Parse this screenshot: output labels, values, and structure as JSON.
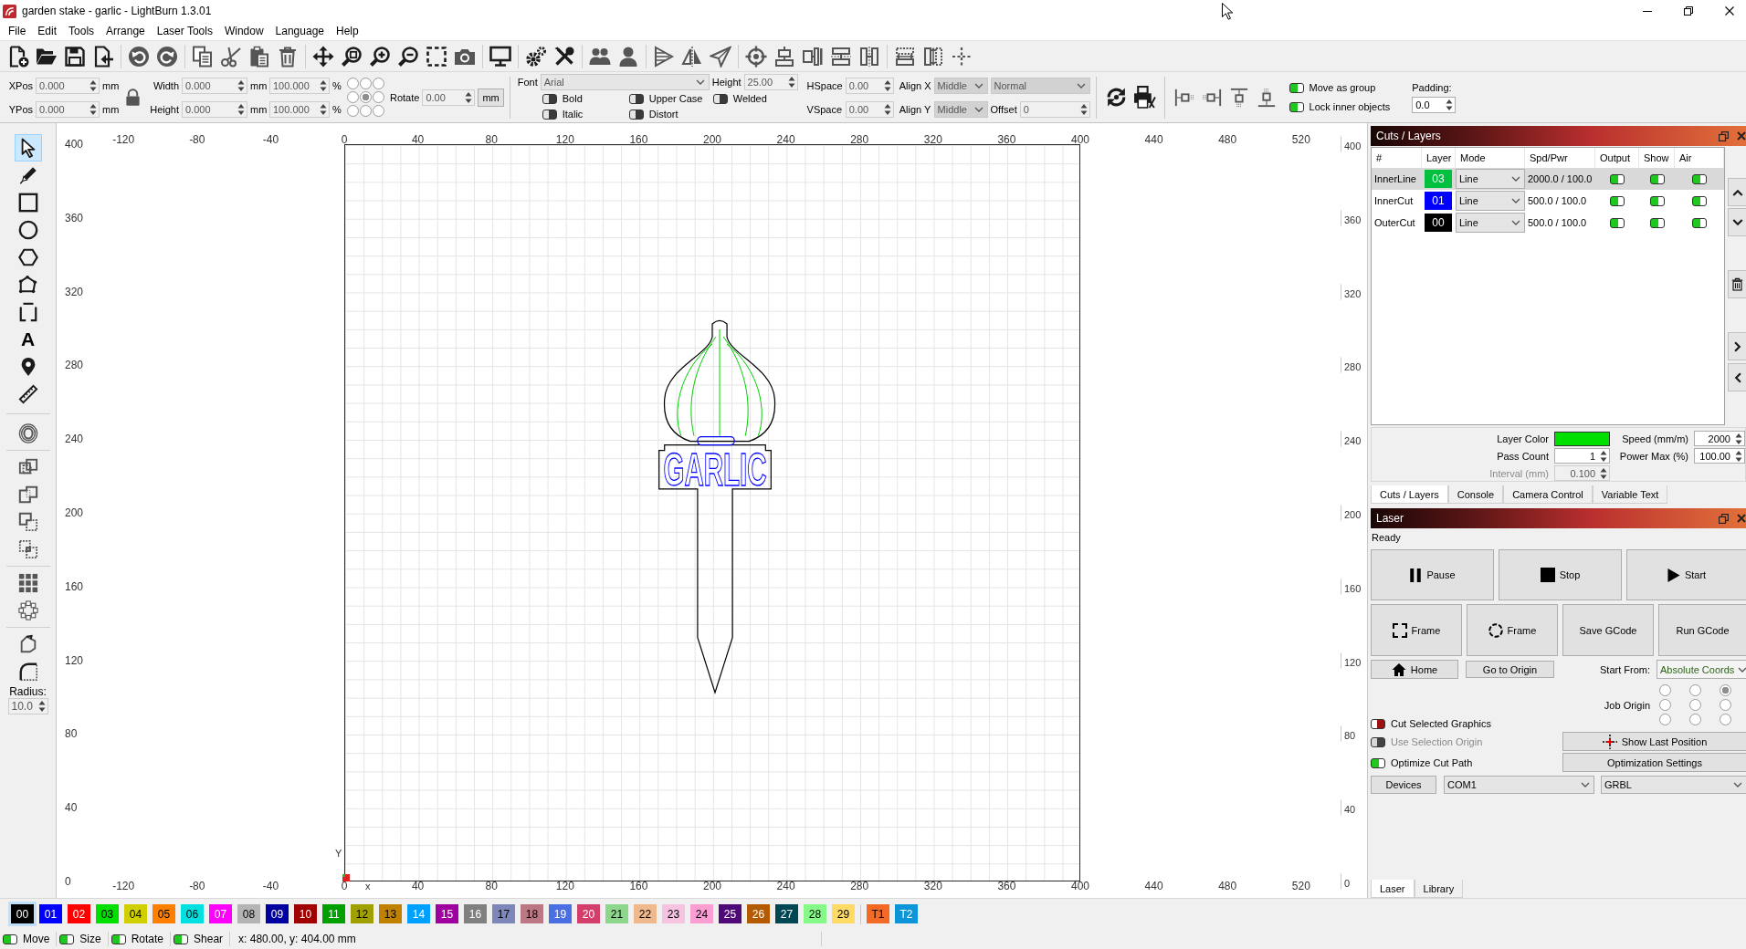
{
  "window": {
    "title": "garden stake - garlic - LightBurn 1.3.01"
  },
  "menu": [
    "File",
    "Edit",
    "Tools",
    "Arrange",
    "Laser Tools",
    "Window",
    "Language",
    "Help"
  ],
  "properties": {
    "position": [
      {
        "label": "XPos",
        "value": "0.000",
        "unit": "mm",
        "disabled": true
      },
      {
        "label": "YPos",
        "value": "0.000",
        "unit": "mm",
        "disabled": true
      }
    ],
    "size": [
      {
        "label": "Width",
        "value": "0.000",
        "unit": "mm",
        "percent": "100.000",
        "percent_unit": "%",
        "disabled": true
      },
      {
        "label": "Height",
        "value": "0.000",
        "unit": "mm",
        "percent": "100.000",
        "percent_unit": "%",
        "disabled": true
      }
    ],
    "origin_points": [
      {
        "selected": false
      },
      {
        "selected": false
      },
      {
        "selected": false
      },
      {
        "selected": false
      },
      {
        "selected": true
      },
      {
        "selected": false
      },
      {
        "selected": false
      },
      {
        "selected": false
      },
      {
        "selected": false
      }
    ],
    "rotate": {
      "label": "Rotate",
      "value": "0.00",
      "disabled": true
    },
    "units_button": "mm",
    "font": {
      "label": "Font",
      "value": "Arial",
      "disabled": true
    },
    "text_height": {
      "label": "Height",
      "value": "25.00",
      "disabled": true
    },
    "text_options": [
      {
        "label": "Bold",
        "on": false
      },
      {
        "label": "Italic",
        "on": false
      },
      {
        "label": "Upper Case",
        "on": false
      },
      {
        "label": "Distort",
        "on": false
      },
      {
        "label": "Welded",
        "on": false
      }
    ],
    "spacing": [
      {
        "label": "HSpace",
        "value": "0.00",
        "disabled": true
      },
      {
        "label": "VSpace",
        "value": "0.00",
        "disabled": true
      }
    ],
    "align": [
      {
        "label": "Align X",
        "value": "Middle",
        "disabled": true
      },
      {
        "label": "Align Y",
        "value": "Middle",
        "disabled": true
      }
    ],
    "text_mode": {
      "value": "Normal",
      "disabled": true
    },
    "offset": {
      "label": "Offset",
      "value": "0",
      "disabled": true
    },
    "group_options": [
      {
        "label": "Move as group",
        "on": true
      },
      {
        "label": "Lock inner objects",
        "on": true
      }
    ],
    "padding": {
      "label": "Padding:",
      "value": "0.0"
    }
  },
  "toolbox": {
    "tools": [
      {
        "selected": true
      },
      {
        "selected": false
      },
      {
        "selected": false
      },
      {
        "selected": false
      },
      {
        "selected": false
      },
      {
        "selected": false
      },
      {
        "selected": false
      },
      {
        "selected": false
      },
      {
        "selected": false
      },
      {
        "selected": false
      }
    ],
    "text_tool_label": "A",
    "radius": {
      "label": "Radius:",
      "value": "10.0",
      "disabled": true
    }
  },
  "canvas": {
    "top_ruler": [
      "-120",
      "-80",
      "-40",
      "0",
      "40",
      "80",
      "120",
      "160",
      "200",
      "240",
      "280",
      "320",
      "360",
      "400",
      "440",
      "480",
      "520"
    ],
    "left_ruler": [
      "400",
      "360",
      "320",
      "280",
      "240",
      "200",
      "160",
      "120",
      "80",
      "40",
      "0"
    ],
    "right_ruler": [
      "400",
      "360",
      "320",
      "280",
      "240",
      "200",
      "160",
      "120",
      "80",
      "40",
      "0"
    ],
    "bottom_ruler": [
      "-120",
      "-80",
      "-40",
      "0",
      "40",
      "80",
      "120",
      "160",
      "200",
      "240",
      "280",
      "320",
      "360",
      "400",
      "440",
      "480",
      "520"
    ],
    "x_axis_label": "x",
    "y_axis_label": "Y",
    "design_text": "GARLIC"
  },
  "cuts_layers": {
    "title": "Cuts / Layers",
    "columns": [
      "#",
      "Layer",
      "Mode",
      "Spd/Pwr",
      "Output",
      "Show",
      "Air"
    ],
    "rows": [
      {
        "name": "InnerLine",
        "layer": "03",
        "color": "#00c040",
        "mode": "Line",
        "speed_power": "2000.0 / 100.0",
        "output": true,
        "show": true,
        "air": true,
        "selected": true
      },
      {
        "name": "InnerCut",
        "layer": "01",
        "color": "#0000ff",
        "mode": "Line",
        "speed_power": "500.0 / 100.0",
        "output": true,
        "show": true,
        "air": true,
        "selected": false
      },
      {
        "name": "OuterCut",
        "layer": "00",
        "color": "#000000",
        "mode": "Line",
        "speed_power": "500.0 / 100.0",
        "output": true,
        "show": true,
        "air": true,
        "selected": false
      }
    ],
    "layer_color": {
      "label": "Layer Color",
      "color": "#00e000"
    },
    "speed": {
      "label": "Speed (mm/m)",
      "value": "2000"
    },
    "pass_count": {
      "label": "Pass Count",
      "value": "1"
    },
    "power_max": {
      "label": "Power Max (%)",
      "value": "100.00"
    },
    "interval": {
      "label": "Interval (mm)",
      "value": "0.100",
      "disabled": true
    },
    "tabs": [
      {
        "label": "Cuts / Layers",
        "selected": true
      },
      {
        "label": "Console",
        "selected": false
      },
      {
        "label": "Camera Control",
        "selected": false
      },
      {
        "label": "Variable Text",
        "selected": false
      }
    ]
  },
  "laser": {
    "title": "Laser",
    "status": "Ready",
    "run_buttons": [
      {
        "label": "Pause",
        "kind": "pause"
      },
      {
        "label": "Stop",
        "kind": "stop"
      },
      {
        "label": "Start",
        "kind": "start"
      }
    ],
    "job_buttons": [
      {
        "label": "Frame",
        "kind": "frame"
      },
      {
        "label": "Frame",
        "kind": "circle_frame"
      },
      {
        "label": "Save GCode",
        "kind": "save_gcode"
      },
      {
        "label": "Run GCode",
        "kind": "run_gcode"
      }
    ],
    "home_button": "Home",
    "go_to_origin_button": "Go to Origin",
    "start_from": {
      "label": "Start From:",
      "value": "Absolute Coords"
    },
    "job_origin": {
      "label": "Job Origin",
      "points": [
        {
          "selected": false
        },
        {
          "selected": false
        },
        {
          "selected": true
        },
        {
          "selected": false
        },
        {
          "selected": false
        },
        {
          "selected": false
        },
        {
          "selected": false
        },
        {
          "selected": false
        },
        {
          "selected": false
        }
      ]
    },
    "options": [
      {
        "label": "Cut Selected Graphics",
        "on": false,
        "disabled": false
      },
      {
        "label": "Use Selection Origin",
        "on": false,
        "disabled": true
      },
      {
        "label": "Optimize Cut Path",
        "on": true,
        "disabled": false
      }
    ],
    "show_last_position_button": "Show Last Position",
    "optimization_settings_button": "Optimization Settings",
    "devices_button": "Devices",
    "port": "COM1",
    "controller": "GRBL",
    "tabs": [
      {
        "label": "Laser",
        "selected": true
      },
      {
        "label": "Library",
        "selected": false
      }
    ]
  },
  "palette": {
    "layers": [
      {
        "label": "00",
        "color": "#000000",
        "selected": true
      },
      {
        "label": "01",
        "color": "#0000ff",
        "selected": false
      },
      {
        "label": "02",
        "color": "#ff0000",
        "selected": false
      },
      {
        "label": "03",
        "color": "#00e000",
        "selected": false
      },
      {
        "label": "04",
        "color": "#d0d000",
        "selected": false
      },
      {
        "label": "05",
        "color": "#ff8000",
        "selected": false
      },
      {
        "label": "06",
        "color": "#00e0e0",
        "selected": false
      },
      {
        "label": "07",
        "color": "#ff00ff",
        "selected": false
      },
      {
        "label": "08",
        "color": "#b4b4b4",
        "selected": false
      },
      {
        "label": "09",
        "color": "#0000a0",
        "selected": false
      },
      {
        "label": "10",
        "color": "#a00000",
        "selected": false
      },
      {
        "label": "11",
        "color": "#00a000",
        "selected": false
      },
      {
        "label": "12",
        "color": "#a0a000",
        "selected": false
      },
      {
        "label": "13",
        "color": "#c08000",
        "selected": false
      },
      {
        "label": "14",
        "color": "#00a0ff",
        "selected": false
      },
      {
        "label": "15",
        "color": "#a000a0",
        "selected": false
      },
      {
        "label": "16",
        "color": "#808080",
        "selected": false
      },
      {
        "label": "17",
        "color": "#7d87b9",
        "selected": false
      },
      {
        "label": "18",
        "color": "#bb7784",
        "selected": false
      },
      {
        "label": "19",
        "color": "#4a6fe3",
        "selected": false
      },
      {
        "label": "20",
        "color": "#d33f6a",
        "selected": false
      },
      {
        "label": "21",
        "color": "#8cd78c",
        "selected": false
      },
      {
        "label": "22",
        "color": "#f0b98d",
        "selected": false
      },
      {
        "label": "23",
        "color": "#f6c4e1",
        "selected": false
      },
      {
        "label": "24",
        "color": "#fa9ed4",
        "selected": false
      },
      {
        "label": "25",
        "color": "#500a78",
        "selected": false
      },
      {
        "label": "26",
        "color": "#b45a00",
        "selected": false
      },
      {
        "label": "27",
        "color": "#004754",
        "selected": false
      },
      {
        "label": "28",
        "color": "#86fa88",
        "selected": false
      },
      {
        "label": "29",
        "color": "#ffdb66",
        "selected": false
      }
    ],
    "tool_layers": [
      {
        "label": "T1",
        "color": "#f36926",
        "selected": false
      },
      {
        "label": "T2",
        "color": "#0c95d8",
        "selected": false
      }
    ]
  },
  "status_bar": {
    "toggles": [
      {
        "label": "Move",
        "on": true
      },
      {
        "label": "Size",
        "on": true
      },
      {
        "label": "Rotate",
        "on": true
      },
      {
        "label": "Shear",
        "on": true
      }
    ],
    "coordinates": "x: 480.00, y: 404.00 mm"
  }
}
